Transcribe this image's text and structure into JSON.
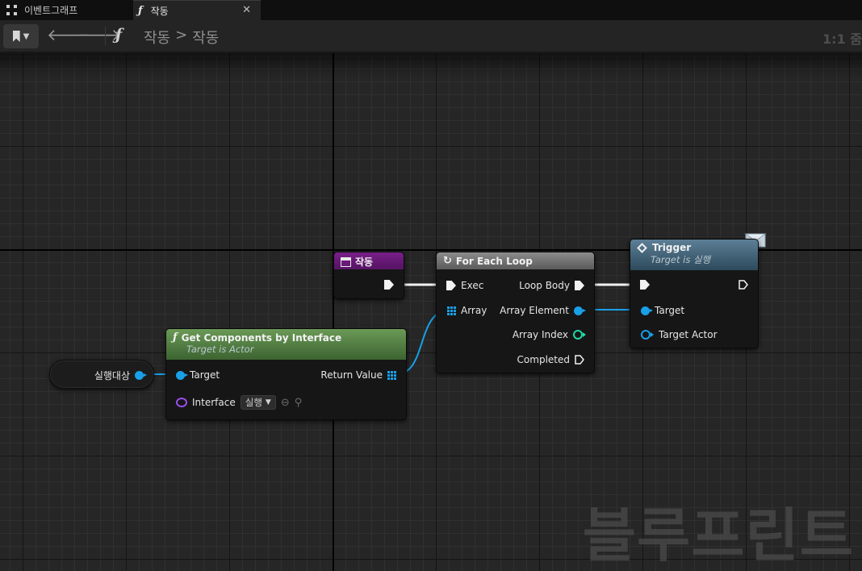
{
  "tabs": [
    {
      "label": "이벤트그래프"
    },
    {
      "label": "작동"
    }
  ],
  "toolbar": {
    "breadcrumb": [
      "작동",
      "작동"
    ],
    "breadcrumb_separator": ">",
    "zoom": "1:1 줌"
  },
  "watermark": "블루프린트",
  "nodes": {
    "variable": {
      "label": "실행대상"
    },
    "custom_event": {
      "title": "작동",
      "color": "#6a1a78"
    },
    "get_components": {
      "title": "Get Components by Interface",
      "subtitle": "Target is Actor",
      "pins": {
        "target": "Target",
        "interface": "Interface",
        "return_value": "Return Value"
      },
      "interface_value": "실행",
      "color": "#4e7a40"
    },
    "for_each_loop": {
      "title": "For Each Loop",
      "pins": {
        "exec": "Exec",
        "array": "Array",
        "loop_body": "Loop Body",
        "array_element": "Array Element",
        "array_index": "Array Index",
        "completed": "Completed"
      }
    },
    "trigger": {
      "title": "Trigger",
      "subtitle": "Target is 실행",
      "pins": {
        "target": "Target",
        "target_actor": "Target Actor"
      },
      "color": "#3d5f75"
    }
  },
  "colors": {
    "object_pin": "#18a0e8",
    "integer_pin": "#1fd9a5",
    "interface_pin": "#9a4df0",
    "exec_pin": "#f2f2f2"
  }
}
